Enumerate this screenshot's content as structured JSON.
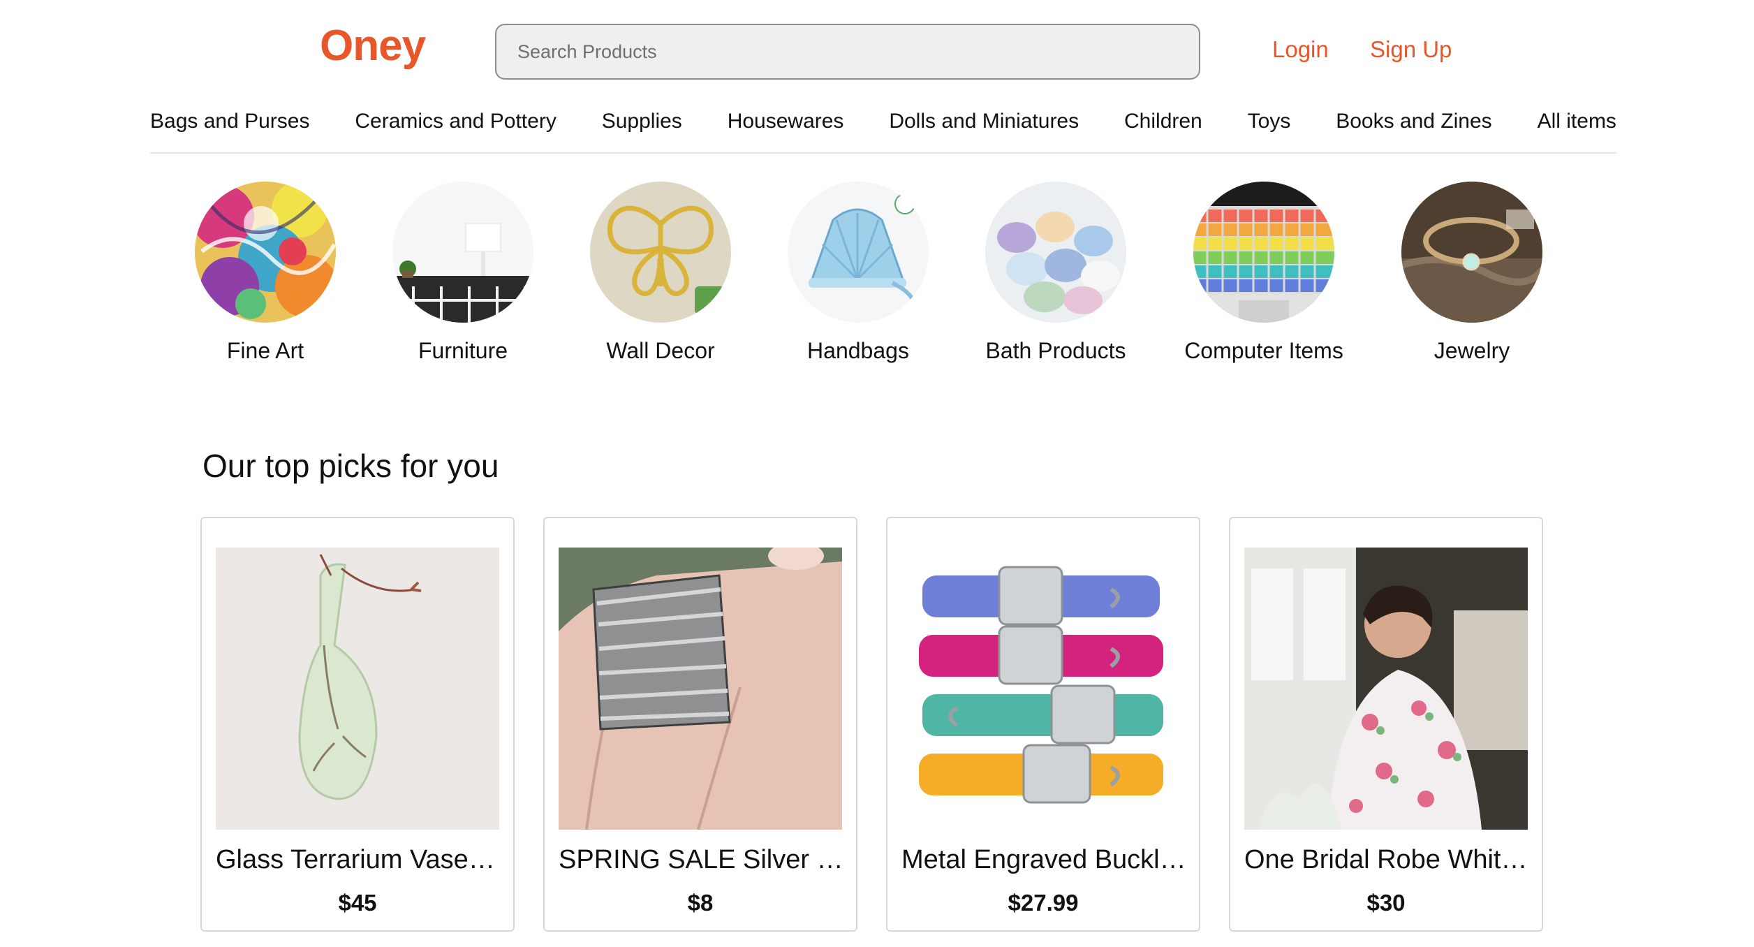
{
  "brand": {
    "logo": "Oney",
    "accent": "#e8562a"
  },
  "search": {
    "placeholder": "Search Products",
    "value": ""
  },
  "auth": {
    "login": "Login",
    "signup": "Sign Up"
  },
  "categories": [
    "Bags and Purses",
    "Ceramics and Pottery",
    "Supplies",
    "Housewares",
    "Dolls and Miniatures",
    "Children",
    "Toys",
    "Books and Zines",
    "All items"
  ],
  "featured_categories": [
    {
      "label": "Fine Art",
      "icon": "fine-art-image"
    },
    {
      "label": "Furniture",
      "icon": "furniture-image"
    },
    {
      "label": "Wall Decor",
      "icon": "butterfly-wall-decor-image"
    },
    {
      "label": "Handbags",
      "icon": "shell-handbag-image"
    },
    {
      "label": "Bath Products",
      "icon": "bath-towels-image"
    },
    {
      "label": "Computer Items",
      "icon": "keyboard-cover-image"
    },
    {
      "label": "Jewelry",
      "icon": "bracelet-image"
    }
  ],
  "top_picks": {
    "title": "Our top picks for you",
    "items": [
      {
        "title": "Glass Terrarium Vase Hanging",
        "price": "$45",
        "image": "glass-vase-image"
      },
      {
        "title": "SPRING SALE Silver Spinner Ring",
        "price": "$8",
        "image": "silver-ring-image"
      },
      {
        "title": "Metal Engraved Buckle Dog Collar",
        "price": "$27.99",
        "image": "dog-collars-image"
      },
      {
        "title": "One Bridal Robe White Floral",
        "price": "$30",
        "image": "bridal-robe-image"
      }
    ]
  }
}
